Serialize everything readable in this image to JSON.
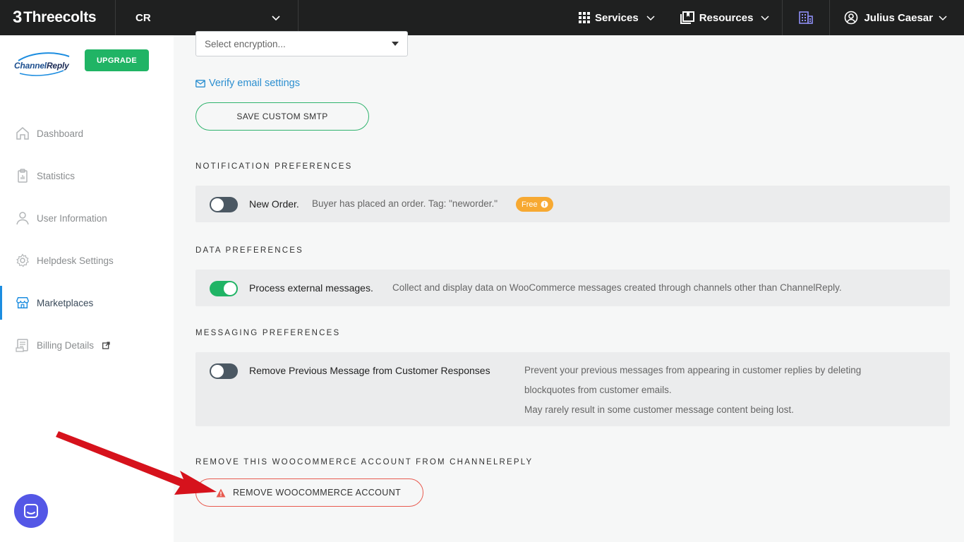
{
  "topbar": {
    "brand": "Threecolts",
    "brand_mark": "3",
    "account": "CR",
    "services": "Services",
    "resources": "Resources",
    "user": "Julius Caesar"
  },
  "sidebar": {
    "logo_channel": "Channel",
    "logo_reply": "Reply",
    "upgrade": "UPGRADE",
    "items": [
      {
        "label": "Dashboard",
        "icon": "home-icon"
      },
      {
        "label": "Statistics",
        "icon": "clipboard-icon"
      },
      {
        "label": "User Information",
        "icon": "user-icon"
      },
      {
        "label": "Helpdesk Settings",
        "icon": "gear-icon"
      },
      {
        "label": "Marketplaces",
        "icon": "store-icon",
        "active": true
      },
      {
        "label": "Billing Details",
        "icon": "billing-icon",
        "external": true
      }
    ]
  },
  "main": {
    "encryption_placeholder": "Select encryption...",
    "verify_link": "Verify email settings",
    "save_smtp": "SAVE CUSTOM SMTP",
    "notification_title": "NOTIFICATION PREFERENCES",
    "new_order": {
      "label": "New Order.",
      "desc": "Buyer has placed an order. Tag: \"neworder.\"",
      "badge": "Free",
      "enabled": false
    },
    "data_title": "DATA PREFERENCES",
    "external": {
      "label": "Process external messages.",
      "desc": "Collect and display data on WooCommerce messages created through channels other than ChannelReply.",
      "enabled": true
    },
    "messaging_title": "MESSAGING PREFERENCES",
    "remove_previous": {
      "label": "Remove Previous Message from Customer Responses",
      "desc1": "Prevent your previous messages from appearing in customer replies by deleting",
      "desc2": "blockquotes from customer emails.",
      "desc3": "May rarely result in some customer message content being lost.",
      "enabled": false
    },
    "remove_title": "REMOVE THIS WOOCOMMERCE ACCOUNT FROM CHANNELREPLY",
    "remove_button": "REMOVE WOOCOMMERCE ACCOUNT"
  },
  "colors": {
    "accent_green": "#20b465",
    "link_blue": "#2c8fd0",
    "danger_red": "#e85a4f",
    "badge_orange": "#f7a932",
    "chat_purple": "#5457e6"
  }
}
